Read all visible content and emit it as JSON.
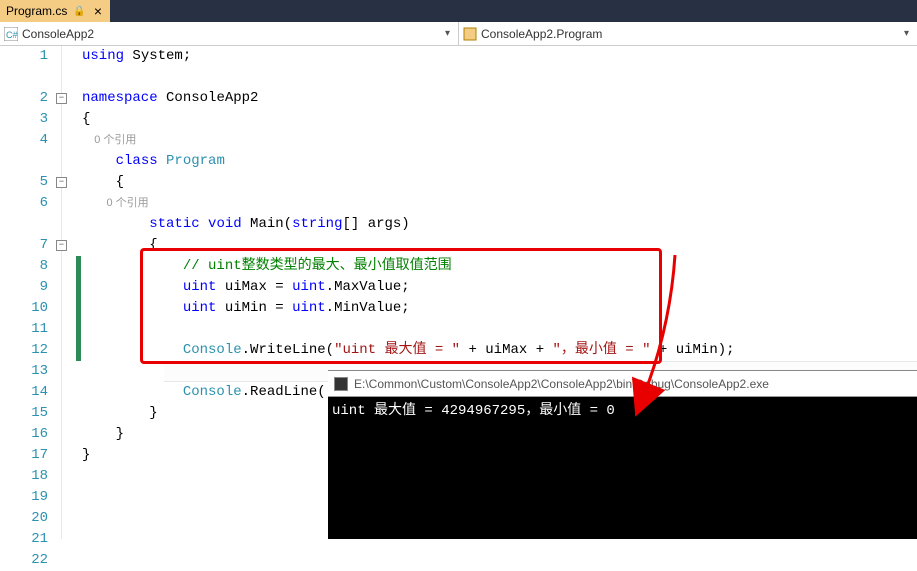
{
  "tab": {
    "filename": "Program.cs",
    "locked": true
  },
  "nav": {
    "left": {
      "text": "ConsoleApp2"
    },
    "right": {
      "text": "ConsoleApp2.Program"
    }
  },
  "code": {
    "codelens": "0 个引用",
    "comment": "// uint整数类型的最大、最小值取值范围",
    "str1": "\"uint 最大值 = \"",
    "str2": "\"，最小值 = \"",
    "namespace_name": "ConsoleApp2",
    "class_name": "Program",
    "method_sig_args": "[] args)",
    "var1": " uiMax = ",
    "var2": " uiMin = ",
    "maxval": ".MaxValue;",
    "minval": ".MinValue;",
    "write": ".WriteLine(",
    "read": ".ReadLine();",
    "plus1": " + uiMax + ",
    "plus2": " + uiMin);"
  },
  "console": {
    "title": "E:\\Common\\Custom\\ConsoleApp2\\ConsoleApp2\\bin\\Debug\\ConsoleApp2.exe",
    "output": "uint 最大值 = 4294967295，最小值 = 0"
  },
  "lines": [
    "1",
    "2",
    "3",
    "4",
    "5",
    "6",
    "7",
    "8",
    "9",
    "10",
    "11",
    "12",
    "13",
    "14",
    "15",
    "16",
    "17",
    "18",
    "19",
    "20",
    "21",
    "22"
  ]
}
